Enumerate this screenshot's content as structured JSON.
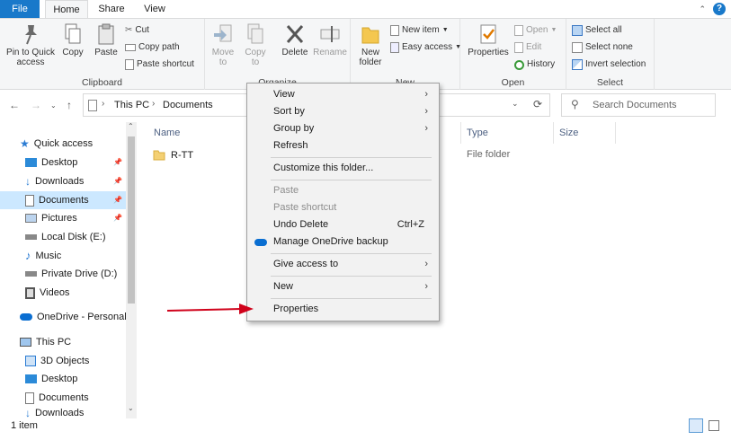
{
  "ribbon_tabs": [
    "File",
    "Home",
    "Share",
    "View"
  ],
  "ribbon": {
    "clipboard": {
      "label": "Clipboard",
      "pin": "Pin to Quick access",
      "copy": "Copy",
      "paste": "Paste",
      "cut": "Cut",
      "copy_path": "Copy path",
      "paste_shortcut": "Paste shortcut"
    },
    "organize": {
      "label": "Organize",
      "move_to": "Move to",
      "copy_to": "Copy to",
      "delete": "Delete",
      "rename": "Rename"
    },
    "new": {
      "label": "New",
      "new_folder": "New folder",
      "new_item": "New item",
      "easy_access": "Easy access"
    },
    "open": {
      "label": "Open",
      "properties": "Properties",
      "open": "Open",
      "edit": "Edit",
      "history": "History"
    },
    "select": {
      "label": "Select",
      "select_all": "Select all",
      "select_none": "Select none",
      "invert": "Invert selection"
    }
  },
  "address": {
    "crumbs": [
      "This PC",
      "Documents"
    ],
    "search_placeholder": "Search Documents"
  },
  "nav_pane": [
    {
      "label": "Quick access",
      "icon": "star-icon"
    },
    {
      "label": "Desktop",
      "icon": "desktop-icon",
      "pinned": true
    },
    {
      "label": "Downloads",
      "icon": "download-icon",
      "pinned": true
    },
    {
      "label": "Documents",
      "icon": "documents-icon",
      "pinned": true,
      "selected": true
    },
    {
      "label": "Pictures",
      "icon": "pictures-icon",
      "pinned": true
    },
    {
      "label": "Local Disk (E:)",
      "icon": "drive-icon"
    },
    {
      "label": "Music",
      "icon": "music-icon"
    },
    {
      "label": "Private Drive (D:)",
      "icon": "drive-icon"
    },
    {
      "label": "Videos",
      "icon": "videos-icon"
    },
    {
      "label": "OneDrive - Personal",
      "icon": "onedrive-icon"
    },
    {
      "label": "This PC",
      "icon": "pc-icon"
    },
    {
      "label": "3D Objects",
      "icon": "3d-objects-icon"
    },
    {
      "label": "Desktop",
      "icon": "desktop-icon"
    },
    {
      "label": "Documents",
      "icon": "documents-icon"
    },
    {
      "label": "Downloads",
      "icon": "download-icon"
    }
  ],
  "columns": {
    "name": "Name",
    "type": "Type",
    "size": "Size"
  },
  "files": [
    {
      "name": "R-TT",
      "type": "File folder",
      "size": ""
    }
  ],
  "context_menu": {
    "view": "View",
    "sort_by": "Sort by",
    "group_by": "Group by",
    "refresh": "Refresh",
    "customize": "Customize this folder...",
    "paste": "Paste",
    "paste_shortcut": "Paste shortcut",
    "undo_delete": "Undo Delete",
    "undo_shortcut": "Ctrl+Z",
    "onedrive_backup": "Manage OneDrive backup",
    "give_access": "Give access to",
    "new": "New",
    "properties": "Properties"
  },
  "status": {
    "item_count": "1 item"
  },
  "colors": {
    "accent": "#1979ca",
    "selection": "#cce8ff",
    "arrow": "#d0021b"
  }
}
